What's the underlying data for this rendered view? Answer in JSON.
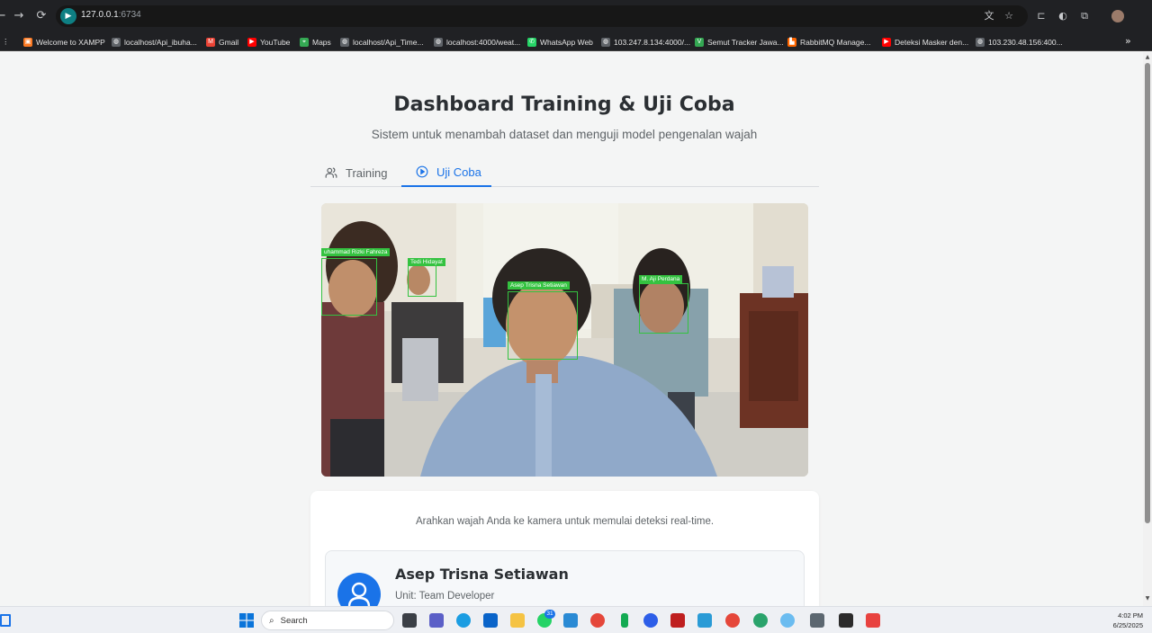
{
  "browser": {
    "url_host": "127.0.0.1",
    "url_port": ":6734",
    "bookmarks": [
      {
        "label": "Welcome to XAMPP",
        "color": "#fb7a24",
        "glyph": "▣"
      },
      {
        "label": "localhost/Api_ibuha...",
        "color": "#5f6368",
        "glyph": "◍"
      },
      {
        "label": "Gmail",
        "color": "#ea4335",
        "glyph": "M"
      },
      {
        "label": "YouTube",
        "color": "#ff0000",
        "glyph": "▶"
      },
      {
        "label": "Maps",
        "color": "#34a853",
        "glyph": "⌖"
      },
      {
        "label": "localhost/Api_Time...",
        "color": "#5f6368",
        "glyph": "◍"
      },
      {
        "label": "localhost:4000/weat...",
        "color": "#5f6368",
        "glyph": "◍"
      },
      {
        "label": "WhatsApp Web",
        "color": "#25d366",
        "glyph": "✆"
      },
      {
        "label": "103.247.8.134:4000/...",
        "color": "#5f6368",
        "glyph": "◍"
      },
      {
        "label": "Semut Tracker Jawa...",
        "color": "#34a853",
        "glyph": "V"
      },
      {
        "label": "RabbitMQ Manage...",
        "color": "#ff6600",
        "glyph": "▙"
      },
      {
        "label": "Deteksi Masker den...",
        "color": "#ff0000",
        "glyph": "▶"
      },
      {
        "label": "103.230.48.156:400...",
        "color": "#5f6368",
        "glyph": "◍"
      }
    ]
  },
  "page": {
    "title": "Dashboard Training & Uji Coba",
    "subtitle": "Sistem untuk menambah dataset dan menguji model pengenalan wajah",
    "tabs": [
      {
        "label": "Training",
        "icon": "users-icon",
        "active": false
      },
      {
        "label": "Uji Coba",
        "icon": "play-circle-icon",
        "active": true
      }
    ],
    "camera": {
      "faces": [
        {
          "label": "uhammad Rizki Fahreza"
        },
        {
          "label": "Tedi Hidayat"
        },
        {
          "label": "Asep Trisna Setiawan"
        },
        {
          "label": "M. Aji Perdana"
        }
      ]
    },
    "hint": "Arahkan wajah Anda ke kamera untuk memulai deteksi real-time.",
    "result": {
      "name": "Asep Trisna Setiawan",
      "unit": "Unit: Team Developer",
      "icon": "user-icon"
    }
  },
  "taskbar": {
    "search_placeholder": "Search",
    "time": "4:02 PM",
    "date": "6/25/2025",
    "whatsapp_badge": "31",
    "accent": "#1a73e8"
  }
}
